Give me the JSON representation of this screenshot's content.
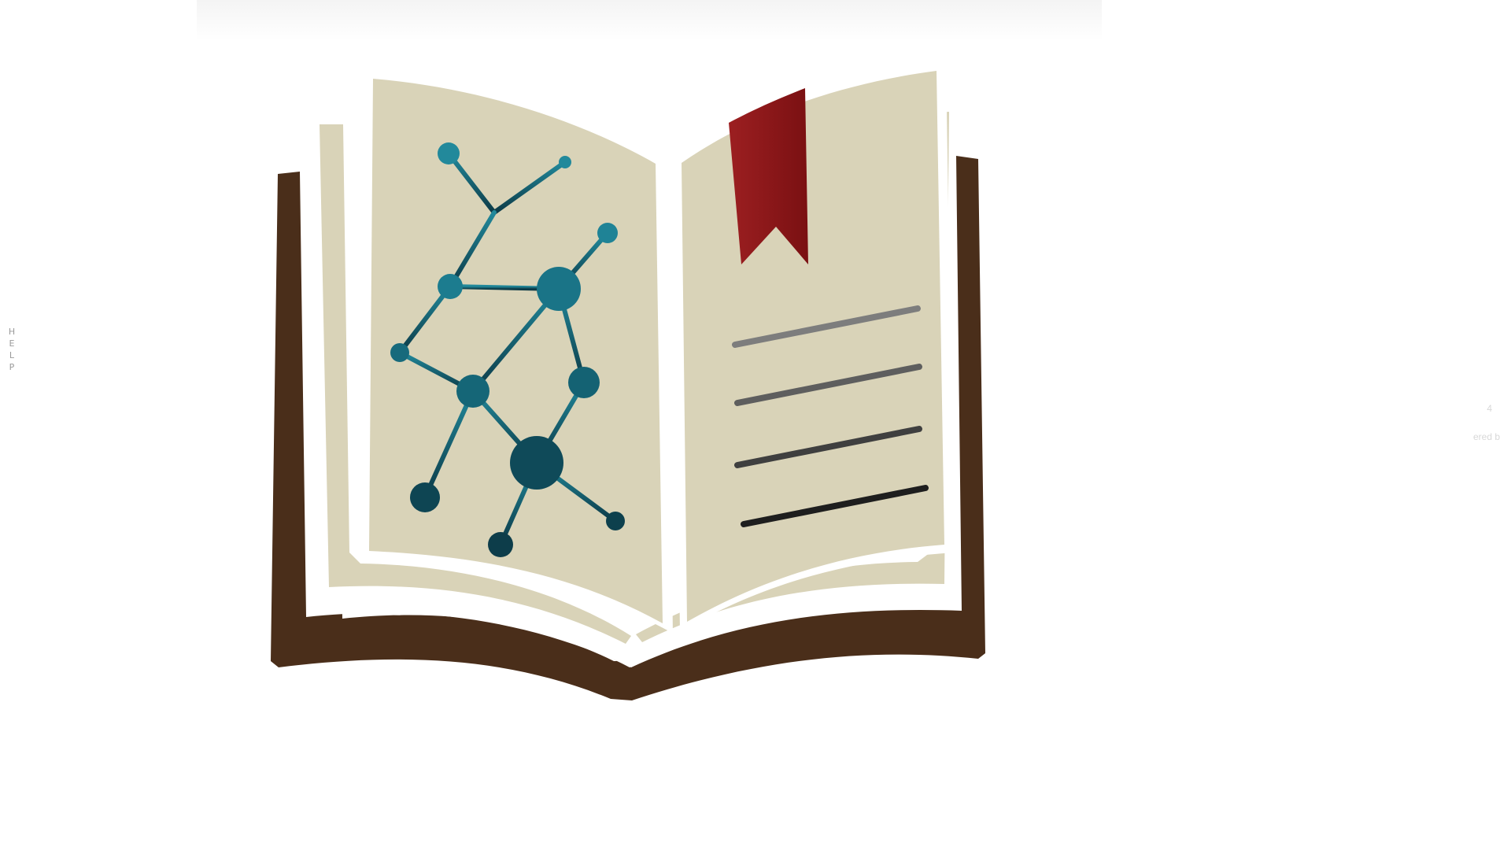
{
  "help_tab": {
    "letters": [
      "H",
      "E",
      "L",
      "P"
    ]
  },
  "faint_labels": {
    "powered": "ered b",
    "corner": "4"
  },
  "logo": {
    "cover_color": "#4a2e1a",
    "page_color": "#d9d3b8",
    "bookmark_color": "#8c1a1c",
    "molecule_colors": [
      "#1f8396",
      "#156677",
      "#0f4a59",
      "#0d3d4a"
    ],
    "text_line_colors": [
      "#7d7d7d",
      "#5e5e5e",
      "#3f3f3f",
      "#1e1e1e"
    ]
  }
}
